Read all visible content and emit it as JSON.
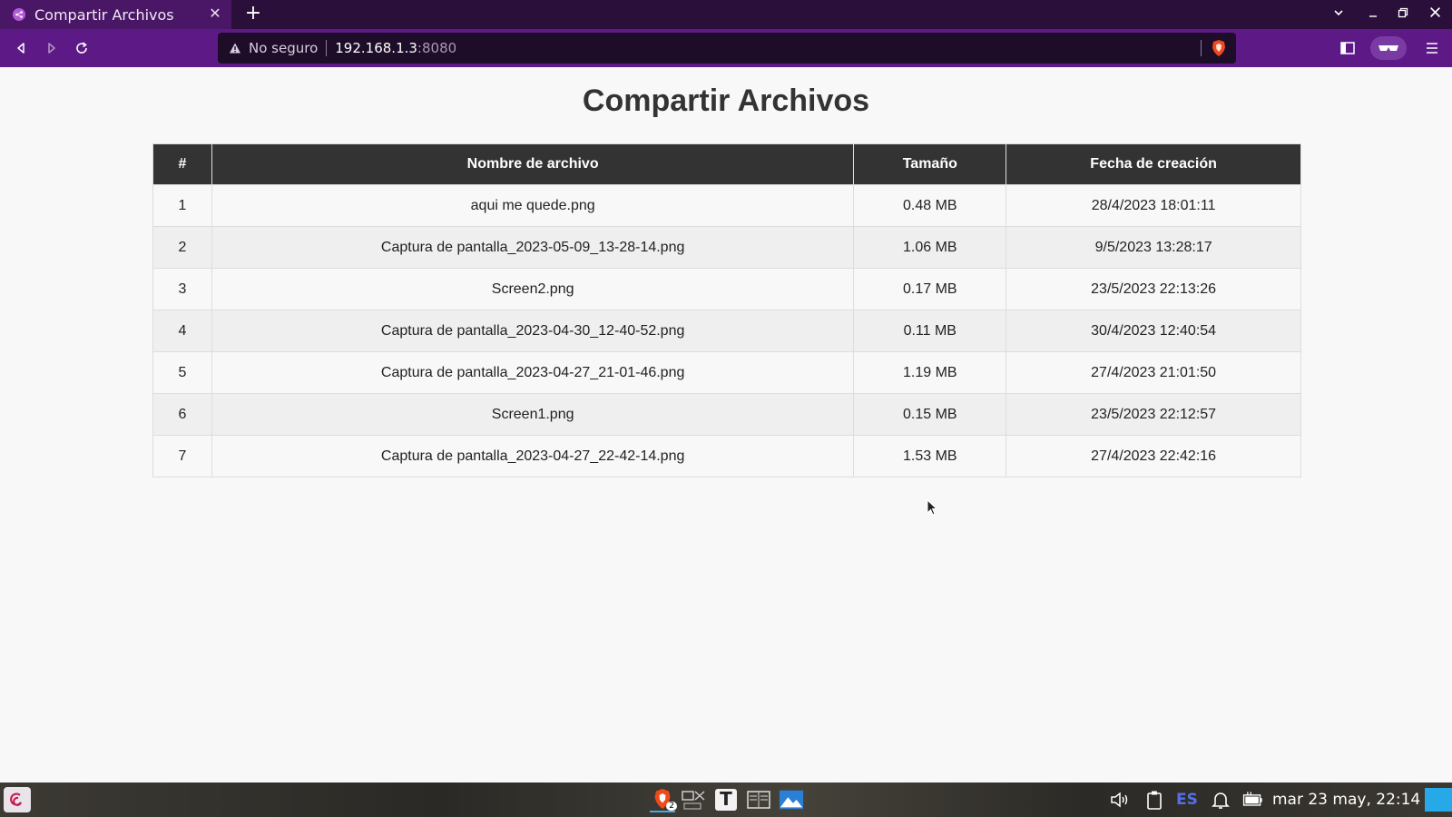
{
  "browser": {
    "tab_title": "Compartir Archivos",
    "tab_close": "✕",
    "new_tab": "+",
    "url_security": "No seguro",
    "url_host": "192.168.1.3",
    "url_port": ":8080",
    "accent": "#5d1a86"
  },
  "page": {
    "title": "Compartir Archivos",
    "table": {
      "headers": [
        "#",
        "Nombre de archivo",
        "Tamaño",
        "Fecha de creación"
      ],
      "rows": [
        {
          "n": "1",
          "name": "aqui me quede.png",
          "size": "0.48 MB",
          "date": "28/4/2023 18:01:11"
        },
        {
          "n": "2",
          "name": "Captura de pantalla_2023-05-09_13-28-14.png",
          "size": "1.06 MB",
          "date": "9/5/2023 13:28:17"
        },
        {
          "n": "3",
          "name": "Screen2.png",
          "size": "0.17 MB",
          "date": "23/5/2023 22:13:26"
        },
        {
          "n": "4",
          "name": "Captura de pantalla_2023-04-30_12-40-52.png",
          "size": "0.11 MB",
          "date": "30/4/2023 12:40:54"
        },
        {
          "n": "5",
          "name": "Captura de pantalla_2023-04-27_21-01-46.png",
          "size": "1.19 MB",
          "date": "27/4/2023 21:01:50"
        },
        {
          "n": "6",
          "name": "Screen1.png",
          "size": "0.15 MB",
          "date": "23/5/2023 22:12:57"
        },
        {
          "n": "7",
          "name": "Captura de pantalla_2023-04-27_22-42-14.png",
          "size": "1.53 MB",
          "date": "27/4/2023 22:42:16"
        }
      ]
    }
  },
  "taskbar": {
    "brave_badge": "2",
    "text_editor_glyph": "T",
    "lang": "ES",
    "clock": "mar 23 may, 22:14"
  }
}
